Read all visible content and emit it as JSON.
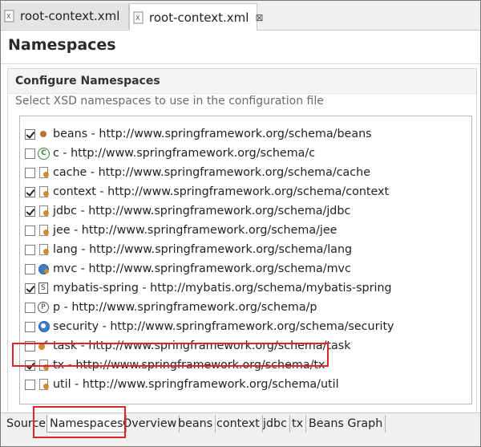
{
  "editor_tabs": [
    {
      "label": "root-context.xml",
      "active": false
    },
    {
      "label": "root-context.xml",
      "active": true,
      "close": "⊠"
    }
  ],
  "page": {
    "title": "Namespaces"
  },
  "section": {
    "title": "Configure Namespaces",
    "description": "Select XSD namespaces to use in the configuration file"
  },
  "namespaces": [
    {
      "label": "beans - http://www.springframework.org/schema/beans",
      "checked": true,
      "icon": "bean-icon"
    },
    {
      "label": "c - http://www.springframework.org/schema/c",
      "checked": false,
      "icon": "c-namespace-icon"
    },
    {
      "label": "cache - http://www.springframework.org/schema/cache",
      "checked": false,
      "icon": "cache-icon"
    },
    {
      "label": "context - http://www.springframework.org/schema/context",
      "checked": true,
      "icon": "context-icon"
    },
    {
      "label": "jdbc - http://www.springframework.org/schema/jdbc",
      "checked": true,
      "icon": "jdbc-icon"
    },
    {
      "label": "jee - http://www.springframework.org/schema/jee",
      "checked": false,
      "icon": "jee-icon"
    },
    {
      "label": "lang - http://www.springframework.org/schema/lang",
      "checked": false,
      "icon": "lang-icon"
    },
    {
      "label": "mvc - http://www.springframework.org/schema/mvc",
      "checked": false,
      "icon": "mvc-globe-icon"
    },
    {
      "label": "mybatis-spring - http://mybatis.org/schema/mybatis-spring",
      "checked": true,
      "icon": "schema-s-icon"
    },
    {
      "label": "p - http://www.springframework.org/schema/p",
      "checked": false,
      "icon": "p-namespace-icon"
    },
    {
      "label": "security - http://www.springframework.org/schema/security",
      "checked": false,
      "icon": "security-icon"
    },
    {
      "label": "task - http://www.springframework.org/schema/task",
      "checked": false,
      "icon": "task-icon"
    },
    {
      "label": "tx - http://www.springframework.org/schema/tx",
      "checked": true,
      "icon": "tx-icon"
    },
    {
      "label": "util - http://www.springframework.org/schema/util",
      "checked": false,
      "icon": "util-icon"
    }
  ],
  "bottom_tabs": [
    {
      "label": "Source",
      "active": false
    },
    {
      "label": "Namespaces",
      "active": true
    },
    {
      "label": "Overview",
      "active": false
    },
    {
      "label": "beans",
      "active": false
    },
    {
      "label": "context",
      "active": false
    },
    {
      "label": "jdbc",
      "active": false
    },
    {
      "label": "tx",
      "active": false
    },
    {
      "label": "Beans Graph",
      "active": false
    }
  ],
  "colors": {
    "highlight": "#e0242b",
    "section_header_bg": "#f4f4f4"
  }
}
